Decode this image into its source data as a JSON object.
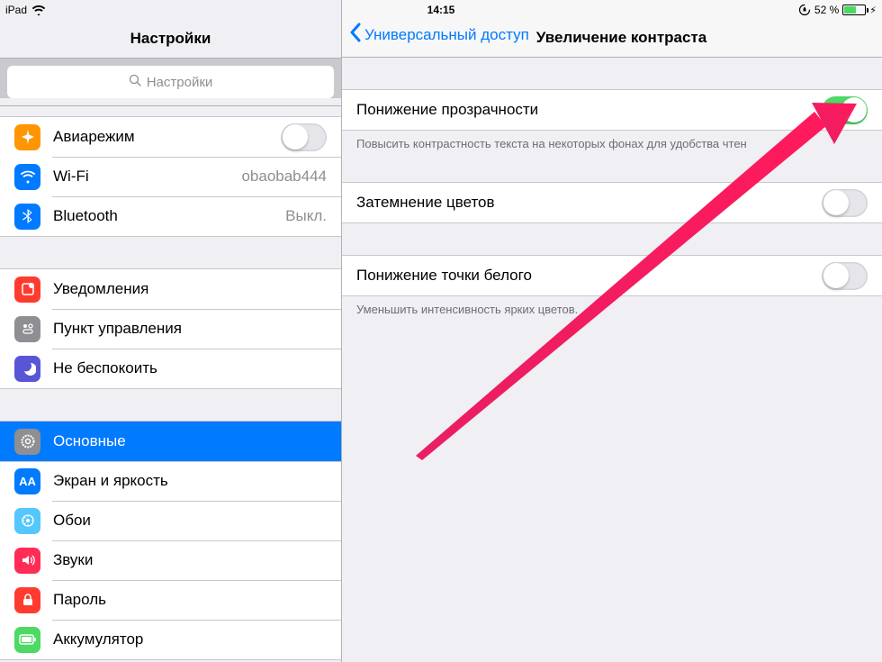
{
  "statusbar": {
    "device": "iPad",
    "time": "14:15",
    "battery_pct": "52 %"
  },
  "sidebar": {
    "title": "Настройки",
    "search_placeholder": "Настройки",
    "groups": [
      {
        "items": [
          {
            "key": "airplane",
            "label": "Авиарежим",
            "toggle": false
          },
          {
            "key": "wifi",
            "label": "Wi-Fi",
            "value": "obaobab444"
          },
          {
            "key": "bluetooth",
            "label": "Bluetooth",
            "value": "Выкл."
          }
        ]
      },
      {
        "items": [
          {
            "key": "notifications",
            "label": "Уведомления"
          },
          {
            "key": "controlcenter",
            "label": "Пункт управления"
          },
          {
            "key": "dnd",
            "label": "Не беспокоить"
          }
        ]
      },
      {
        "items": [
          {
            "key": "general",
            "label": "Основные",
            "selected": true
          },
          {
            "key": "display",
            "label": "Экран и яркость"
          },
          {
            "key": "wallpaper",
            "label": "Обои"
          },
          {
            "key": "sounds",
            "label": "Звуки"
          },
          {
            "key": "passcode",
            "label": "Пароль"
          },
          {
            "key": "battery",
            "label": "Аккумулятор"
          }
        ]
      }
    ]
  },
  "detail": {
    "back_label": "Универсальный доступ",
    "title": "Увеличение контраста",
    "rows": [
      {
        "label": "Понижение прозрачности",
        "toggle": true,
        "footer": "Повысить контрастность текста на некоторых фонах для удобства чтен"
      },
      {
        "label": "Затемнение цветов",
        "toggle": false
      },
      {
        "label": "Понижение точки белого",
        "toggle": false,
        "footer": "Уменьшить интенсивность ярких цветов."
      }
    ]
  },
  "annotation": {
    "color": "#e91e63"
  }
}
